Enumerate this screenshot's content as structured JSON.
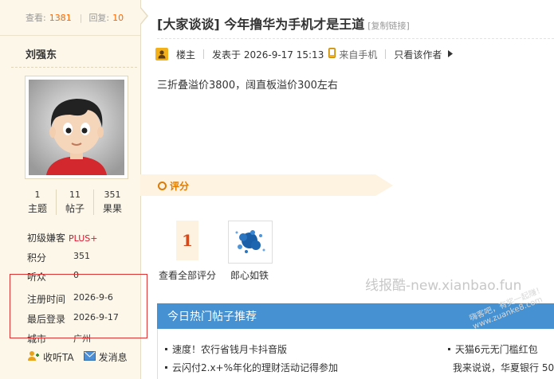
{
  "stats": {
    "views_label": "查看:",
    "views": "1381",
    "replies_label": "回复:",
    "replies": "10"
  },
  "author": {
    "name": "刘强东"
  },
  "counts": [
    {
      "value": "1",
      "label": "主题"
    },
    {
      "value": "11",
      "label": "帖子"
    },
    {
      "value": "351",
      "label": "果果"
    }
  ],
  "profile": {
    "level_label": "初级嫌客",
    "level_badge": "PLUS+",
    "points_label": "积分",
    "points": "351",
    "listeners_label": "听众",
    "listeners": "0",
    "register_label": "注册时间",
    "register": "2026-9-6",
    "last_login_label": "最后登录",
    "last_login": "2026-9-17",
    "city_label": "城市",
    "city": "广州"
  },
  "actions": {
    "follow": "收听TA",
    "message": "发消息"
  },
  "post": {
    "title": "[大家谈谈] 今年撸华为手机才是王道",
    "copy_link": "[复制链接]",
    "floor": "楼主",
    "posted": "发表于 2026-9-17 15:13",
    "source": "来自手机",
    "only_author": "只看该作者",
    "content": "三折叠溢价3800，阔直板溢价300左右"
  },
  "rating": {
    "label": "评分",
    "score": "1",
    "view_all": "查看全部评分",
    "rater": "郎心如铁"
  },
  "watermark": "线报酷-new.xianbao.fun",
  "stamp": {
    "line1": "嗨客吧，有奖一起赚！",
    "line2": "www.zuanke8.com"
  },
  "hot": {
    "title": "今日热门帖子推荐",
    "items": [
      "速度！农行省钱月卡抖音版",
      "天猫6元无门槛红包",
      "云闪付2.x+%年化的理财活动记得参加",
      "我来说说，华夏银行 50"
    ]
  },
  "colors": {
    "accent": "#ff6600",
    "hot_header": "#4591d2",
    "sidebar_bg": "#fdf7ea",
    "highlight_box": "#dd3333"
  }
}
